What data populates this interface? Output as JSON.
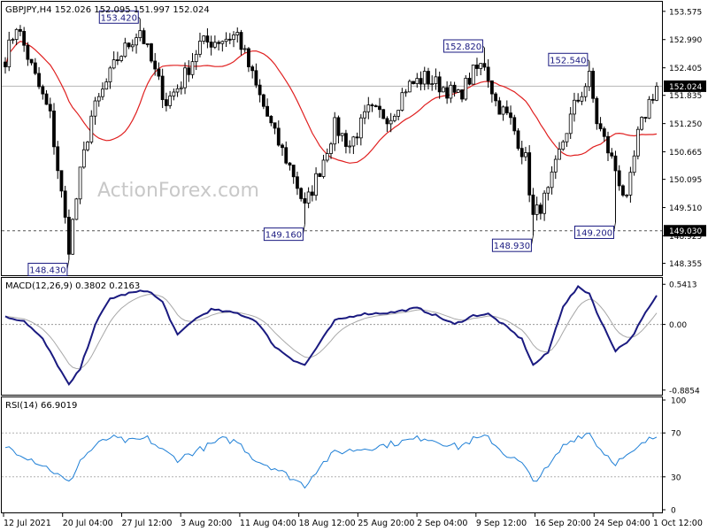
{
  "chart_data": [
    {
      "type": "candlestick",
      "header": "GBPJPY,H4  152.026 152.095 151.997 152.024",
      "watermark": "ActionForex.com",
      "ylim": [
        148.2,
        153.7
      ],
      "yticks": [
        "153.575",
        "152.990",
        "152.405",
        "151.835",
        "151.250",
        "150.665",
        "150.095",
        "149.510",
        "148.925",
        "148.355"
      ],
      "current_price": "152.024",
      "support_level": "149.030",
      "series_colors": {
        "candles": "#000000",
        "ma": "#e02020",
        "current_line": "#b4b4b4",
        "support_line": "#555555"
      },
      "callouts": [
        {
          "label": "153.420",
          "index": 36,
          "value": 153.42,
          "side": "above"
        },
        {
          "label": "152.820",
          "index": 128,
          "value": 152.82,
          "side": "above"
        },
        {
          "label": "152.540",
          "index": 156,
          "value": 152.54,
          "side": "above"
        },
        {
          "label": "148.430",
          "index": 17,
          "value": 148.43,
          "side": "below"
        },
        {
          "label": "149.160",
          "index": 80,
          "value": 149.16,
          "side": "below"
        },
        {
          "label": "148.930",
          "index": 141,
          "value": 148.93,
          "side": "below"
        },
        {
          "label": "149.200",
          "index": 163,
          "value": 149.2,
          "side": "below"
        }
      ],
      "price_anchors": [
        [
          0,
          152.6
        ],
        [
          3,
          153.3
        ],
        [
          8,
          152.2
        ],
        [
          12,
          151.4
        ],
        [
          17,
          148.7
        ],
        [
          20,
          150.2
        ],
        [
          23,
          151.4
        ],
        [
          30,
          152.6
        ],
        [
          36,
          153.2
        ],
        [
          40,
          152.3
        ],
        [
          43,
          151.7
        ],
        [
          47,
          152.1
        ],
        [
          52,
          152.9
        ],
        [
          58,
          153.0
        ],
        [
          62,
          153.1
        ],
        [
          67,
          152.0
        ],
        [
          72,
          151.0
        ],
        [
          77,
          150.2
        ],
        [
          80,
          149.5
        ],
        [
          84,
          150.3
        ],
        [
          88,
          151.2
        ],
        [
          92,
          150.8
        ],
        [
          97,
          151.5
        ],
        [
          103,
          151.4
        ],
        [
          107,
          152.0
        ],
        [
          112,
          152.2
        ],
        [
          117,
          152.0
        ],
        [
          121,
          151.8
        ],
        [
          125,
          152.3
        ],
        [
          128,
          152.5
        ],
        [
          131,
          151.7
        ],
        [
          135,
          151.3
        ],
        [
          139,
          150.5
        ],
        [
          141,
          149.3
        ],
        [
          145,
          149.8
        ],
        [
          149,
          150.9
        ],
        [
          152,
          151.6
        ],
        [
          156,
          152.2
        ],
        [
          158,
          151.3
        ],
        [
          161,
          150.7
        ],
        [
          163,
          150.3
        ],
        [
          166,
          149.6
        ],
        [
          169,
          151.0
        ],
        [
          172,
          151.7
        ],
        [
          174,
          152.02
        ]
      ]
    },
    {
      "type": "line",
      "label": "MACD(12,26,9) 0.3802 0.2163",
      "ylim": [
        -0.9,
        0.58
      ],
      "yticks": [
        "0.5413",
        "0.00",
        "-0.8854"
      ],
      "colors": {
        "macd": "#1a1a80",
        "signal": "#a8a8a8"
      },
      "values_anchors": [
        [
          0,
          0.1
        ],
        [
          5,
          0.05
        ],
        [
          10,
          -0.2
        ],
        [
          14,
          -0.55
        ],
        [
          17,
          -0.82
        ],
        [
          20,
          -0.6
        ],
        [
          24,
          0.0
        ],
        [
          28,
          0.35
        ],
        [
          33,
          0.42
        ],
        [
          38,
          0.46
        ],
        [
          42,
          0.3
        ],
        [
          46,
          -0.15
        ],
        [
          50,
          0.05
        ],
        [
          55,
          0.2
        ],
        [
          62,
          0.15
        ],
        [
          67,
          0.05
        ],
        [
          72,
          -0.3
        ],
        [
          77,
          -0.48
        ],
        [
          80,
          -0.55
        ],
        [
          84,
          -0.25
        ],
        [
          88,
          0.05
        ],
        [
          95,
          0.14
        ],
        [
          103,
          0.16
        ],
        [
          110,
          0.22
        ],
        [
          115,
          0.12
        ],
        [
          120,
          0.0
        ],
        [
          125,
          0.12
        ],
        [
          129,
          0.14
        ],
        [
          133,
          0.0
        ],
        [
          138,
          -0.2
        ],
        [
          141,
          -0.55
        ],
        [
          145,
          -0.38
        ],
        [
          149,
          0.25
        ],
        [
          153,
          0.5
        ],
        [
          156,
          0.42
        ],
        [
          159,
          0.05
        ],
        [
          163,
          -0.35
        ],
        [
          167,
          -0.2
        ],
        [
          171,
          0.15
        ],
        [
          174,
          0.38
        ]
      ]
    },
    {
      "type": "line",
      "label": "RSI(14) 66.9019",
      "ylim": [
        0,
        100
      ],
      "yticks": [
        "100",
        "70",
        "30",
        "0"
      ],
      "levels": [
        70,
        30
      ],
      "color": "#1e7fd6",
      "values_anchors": [
        [
          0,
          58
        ],
        [
          6,
          48
        ],
        [
          12,
          37
        ],
        [
          17,
          24
        ],
        [
          20,
          45
        ],
        [
          24,
          58
        ],
        [
          28,
          66
        ],
        [
          33,
          62
        ],
        [
          38,
          65
        ],
        [
          42,
          54
        ],
        [
          46,
          46
        ],
        [
          52,
          55
        ],
        [
          58,
          64
        ],
        [
          62,
          62
        ],
        [
          67,
          45
        ],
        [
          72,
          38
        ],
        [
          77,
          28
        ],
        [
          80,
          22
        ],
        [
          84,
          40
        ],
        [
          88,
          52
        ],
        [
          94,
          55
        ],
        [
          100,
          58
        ],
        [
          106,
          62
        ],
        [
          112,
          66
        ],
        [
          117,
          61
        ],
        [
          121,
          57
        ],
        [
          125,
          64
        ],
        [
          129,
          66
        ],
        [
          133,
          52
        ],
        [
          138,
          42
        ],
        [
          141,
          26
        ],
        [
          145,
          38
        ],
        [
          149,
          58
        ],
        [
          153,
          67
        ],
        [
          156,
          70
        ],
        [
          159,
          55
        ],
        [
          163,
          43
        ],
        [
          167,
          50
        ],
        [
          171,
          62
        ],
        [
          174,
          67
        ]
      ]
    }
  ],
  "xticks": [
    "12 Jul 2021",
    "20 Jul 04:00",
    "27 Jul 12:00",
    "3 Aug 20:00",
    "11 Aug 04:00",
    "18 Aug 12:00",
    "25 Aug 20:00",
    "2 Sep 04:00",
    "9 Sep 12:00",
    "16 Sep 20:00",
    "24 Sep 04:00",
    "1 Oct 12:00"
  ],
  "bar_count": 175
}
